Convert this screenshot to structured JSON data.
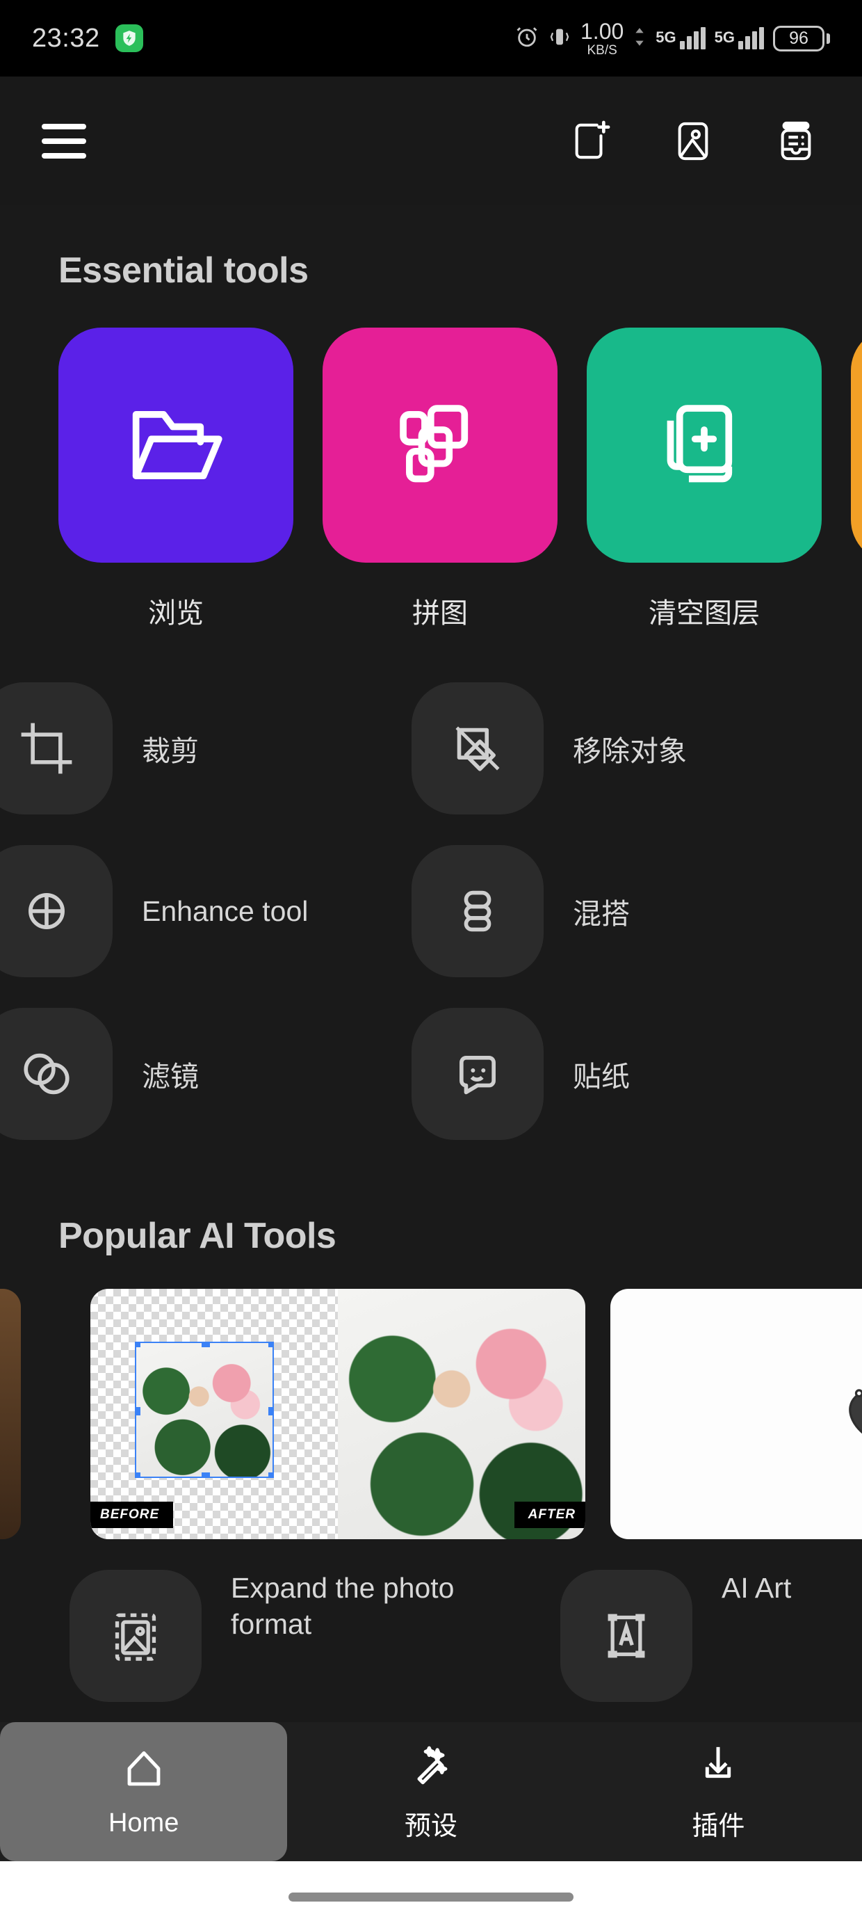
{
  "statusbar": {
    "time": "23:32",
    "shield_icon": "shield-bolt-icon",
    "alarm_icon": "alarm-clock-icon",
    "vibrate_icon": "vibrate-icon",
    "net_speed_value": "1.00",
    "net_speed_unit": "KB/S",
    "sim1_network": "5G",
    "sim2_network": "5G",
    "battery_percent": "96"
  },
  "appbar": {
    "menu_icon": "hamburger-menu-icon",
    "new_project_icon": "new-project-sparkle-icon",
    "gallery_icon": "gallery-image-icon",
    "archive_icon": "archive-inbox-icon"
  },
  "essential": {
    "title": "Essential tools",
    "cards": [
      {
        "label": "浏览",
        "color": "#5b21e8",
        "icon": "folder-open-icon"
      },
      {
        "label": "拼图",
        "color": "#e51f96",
        "icon": "collage-layers-icon"
      },
      {
        "label": "清空图层",
        "color": "#18b98a",
        "icon": "new-layer-plus-icon"
      },
      {
        "label": "",
        "color": "#f2a026",
        "icon": "partial-card-icon"
      }
    ],
    "list": [
      {
        "left_label": "裁剪",
        "left_icon": "crop-icon",
        "right_label": "移除对象",
        "right_icon": "remove-object-icon"
      },
      {
        "left_label": "Enhance tool",
        "left_icon": "enhance-icon",
        "right_label": "混搭",
        "right_icon": "mix-match-icon"
      },
      {
        "left_label": "滤镜",
        "left_icon": "filter-icon",
        "right_label": "贴纸",
        "right_icon": "sticker-smiley-icon"
      }
    ]
  },
  "popular_ai": {
    "title": "Popular AI Tools",
    "before_label": "BEFORE",
    "after_label": "AFTER",
    "items": [
      {
        "label": "Expand the photo format",
        "icon": "expand-photo-icon"
      },
      {
        "label": "AI Art",
        "icon": "ai-art-frame-icon"
      }
    ]
  },
  "bottomnav": {
    "items": [
      {
        "label": "Home",
        "icon": "home-icon",
        "active": true
      },
      {
        "label": "预设",
        "icon": "magic-wand-icon",
        "active": false
      },
      {
        "label": "插件",
        "icon": "download-plugin-icon",
        "active": false
      }
    ]
  }
}
